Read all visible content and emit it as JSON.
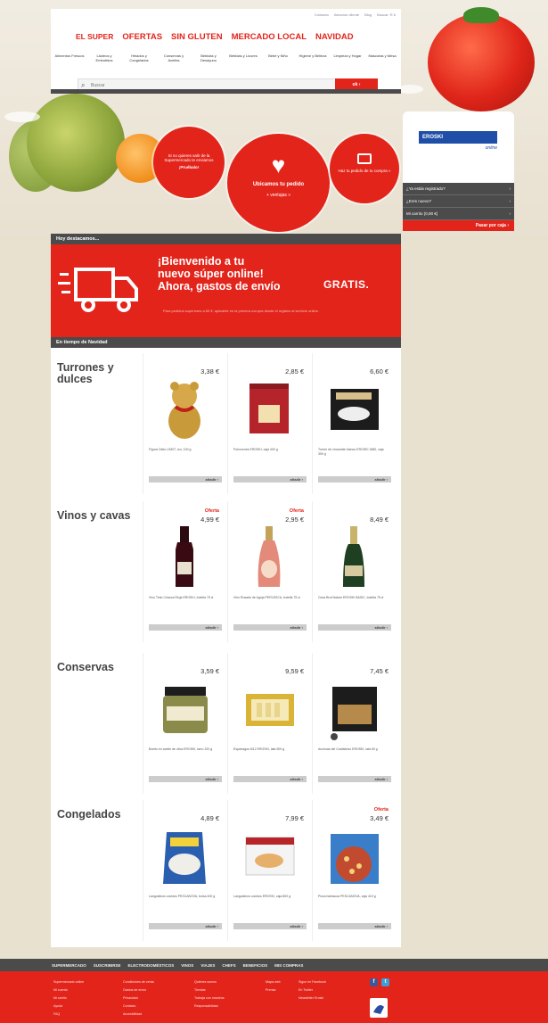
{
  "header": {
    "toplinks": [
      "Contacto",
      "Atención cliente",
      "Blog",
      "Buscar: R 6"
    ],
    "mainnav": [
      "EL SUPER",
      "OFERTAS",
      "SIN GLUTEN",
      "MERCADO LOCAL",
      "NAVIDAD"
    ],
    "subnav": [
      "Alimentos Frescos",
      "Lácteos y Embutidos",
      "Helados y Congelados",
      "Conservas y Aceites",
      "Bebidas y Desayuno",
      "Bebidas y Licores",
      "Bebé y Niño",
      "Higiene y Belleza",
      "Limpieza y Hogar",
      "Mascotas y Mesa"
    ],
    "search": {
      "placeholder": "Buscar",
      "button": "ok ›"
    }
  },
  "bubbles": {
    "b1": {
      "text": "Si no quieres salir de la Supermercado te enviamos",
      "cta": "¡Pruébalo!"
    },
    "b2": {
      "text": "Ubicamos tu pedido",
      "cta": "+ ventajas »"
    },
    "b3": {
      "text": "Haz tu pedido de tu compra »"
    }
  },
  "login": {
    "brand": "EROSKI",
    "brand_sub": "online",
    "rows": [
      "¿Ya estás registrado?",
      "¿Eres nuevo?",
      "Mi carrito (0,00 €)"
    ],
    "pay": "Pasar por caja ›"
  },
  "sections": {
    "featured": "Hoy destacamos...",
    "christmas": "En tiempo de Navidad"
  },
  "promo": {
    "line1": "¡Bienvenido a tu",
    "line2": "nuevo súper online!",
    "line3": "Ahora, gastos de envío",
    "free": "GRATIS.",
    "small": "Para pedidos superiores a 60 €, aplicable en la primera compra desde el registro al servicio online."
  },
  "categories": [
    {
      "title": "Turrones y dulces",
      "products": [
        {
          "offer": "",
          "price": "3,38 €",
          "name": "Figura Osito LINDT, oro, 100 g",
          "btn": "añadir ›"
        },
        {
          "offer": "",
          "price": "2,85 €",
          "name": "Polvorones EROSKI, caja 400 g",
          "btn": "añadir ›"
        },
        {
          "offer": "",
          "price": "6,60 €",
          "name": "Turrón de chocolate blanco EROSKI 1880, caja 300 g",
          "btn": "añadir ›"
        }
      ]
    },
    {
      "title": "Vinos y cavas",
      "products": [
        {
          "offer": "Oferta",
          "price": "4,99 €",
          "name": "Vino Tinto Crianza Rioja EROSKI, botella 75 cl",
          "btn": "añadir ›"
        },
        {
          "offer": "Oferta",
          "price": "2,95 €",
          "name": "Vino Rosado de Aguja PERLESCA, botella 75 cl",
          "btn": "añadir ›"
        },
        {
          "offer": "",
          "price": "8,49 €",
          "name": "Cava Brut Nature EROSKI BASIC, botella 75 cl",
          "btn": "añadir ›"
        }
      ]
    },
    {
      "title": "Conservas",
      "products": [
        {
          "offer": "",
          "price": "3,59 €",
          "name": "Bonito en aceite de oliva EROSKI, tarro 220 g",
          "btn": "añadir ›"
        },
        {
          "offer": "",
          "price": "9,59 €",
          "name": "Espárragos 6/12 EROSKI, lata 500 g",
          "btn": "añadir ›"
        },
        {
          "offer": "",
          "price": "7,45 €",
          "name": "Anchoas del Cantábrico EROSKI, lata 50 g",
          "btn": "añadir ›"
        }
      ]
    },
    {
      "title": "Congelados",
      "products": [
        {
          "offer": "",
          "price": "4,89 €",
          "name": "Langostinos cocidos PESCANOVA, bolsa 400 g",
          "btn": "añadir ›"
        },
        {
          "offer": "",
          "price": "7,99 €",
          "name": "Langostinos cocidos EROSKI, caja 800 g",
          "btn": "añadir ›"
        },
        {
          "offer": "Oferta",
          "price": "3,49 €",
          "name": "Pizza barbacoa PESCANOVA, caja 410 g",
          "btn": "añadir ›"
        }
      ]
    }
  ],
  "footer": {
    "nav": [
      "SUPERMERCADO",
      "SUSCRIBIRSE",
      "ELECTRODOMÉSTICOS",
      "VINOS",
      "VIAJES",
      "CHEFS",
      "BENEFICIOS",
      "MIS COMPRAS"
    ],
    "col1": [
      "Supermercado online",
      "Mi cuenta",
      "Mi carrito",
      "Ayuda",
      "FAQ"
    ],
    "col2": [
      "Condiciones de venta",
      "Gastos de envío",
      "Privacidad",
      "Contacto",
      "Accesibilidad"
    ],
    "col3": [
      "Quiénes somos",
      "Tiendas",
      "Trabaja con nosotros",
      "Responsabilidad"
    ],
    "col4": [
      "Mapa web",
      "Prensa"
    ],
    "col5": [
      "Sigue en Facebook",
      "En Twitter",
      "Newsletter Eroski"
    ],
    "social": [
      "f",
      "t"
    ]
  },
  "colors": {
    "brand": "#e3241b",
    "dark": "#4b4b4b"
  }
}
